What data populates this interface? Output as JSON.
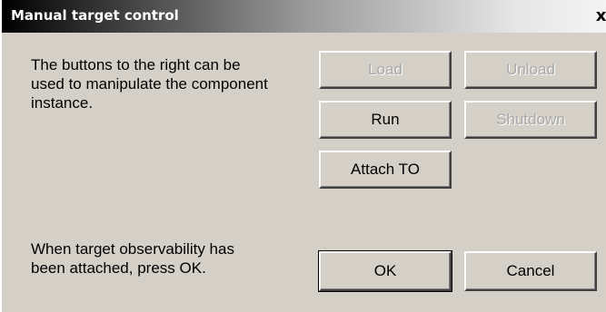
{
  "window": {
    "title": "Manual target control",
    "close_glyph": "x"
  },
  "messages": {
    "instructions": "The buttons to the right can be\nused to manipulate the component\ninstance.",
    "attach_hint": "When target observability has\nbeen attached, press OK."
  },
  "buttons": {
    "load": {
      "label": "Load",
      "enabled": false
    },
    "unload": {
      "label": "Unload",
      "enabled": false
    },
    "run": {
      "label": "Run",
      "enabled": true
    },
    "shutdown": {
      "label": "Shutdown",
      "enabled": false
    },
    "attach": {
      "label": "Attach TO",
      "enabled": true
    },
    "ok": {
      "label": "OK",
      "enabled": true,
      "default": true
    },
    "cancel": {
      "label": "Cancel",
      "enabled": true
    }
  },
  "colors": {
    "face": "#d4d0c8",
    "disabled_text": "#a8a8a8",
    "title_start": "#000000",
    "title_end": "#f4f4f4"
  }
}
